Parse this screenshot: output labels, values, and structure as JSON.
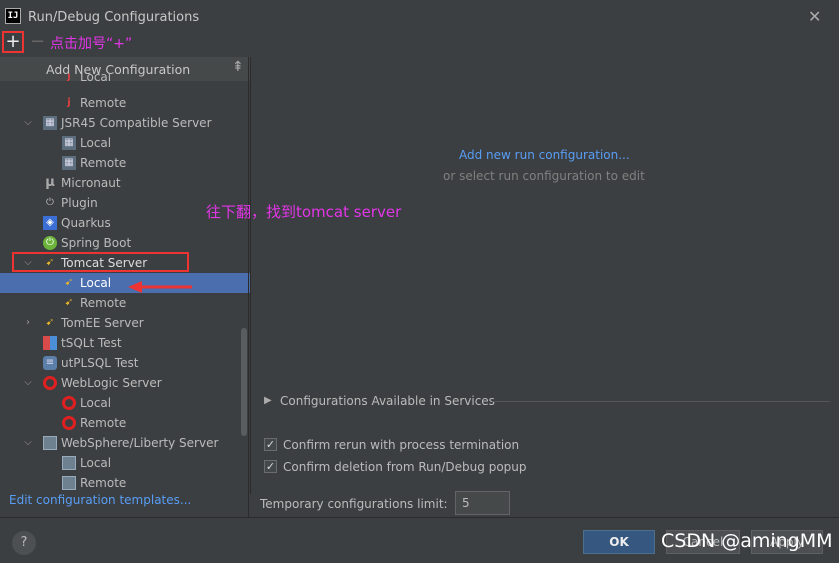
{
  "window": {
    "title": "Run/Debug Configurations",
    "icon": "intellij-icon",
    "close_glyph": "✕"
  },
  "toolbar": {
    "add_label": "+",
    "remove_label": "−"
  },
  "annotations": {
    "click_plus": "点击加号“+”",
    "scroll_down": "往下翻，找到tomcat server"
  },
  "popup": {
    "header": "Add New Configuration",
    "rows": [
      {
        "label": "Local",
        "icon": "jetty-icon"
      },
      {
        "label": "Remote",
        "icon": "jetty-icon"
      },
      {
        "label": "JSR45 Compatible Server",
        "icon": "jsr45-icon"
      },
      {
        "label": "Local",
        "icon": "jsr45-icon"
      },
      {
        "label": "Remote",
        "icon": "jsr45-icon"
      },
      {
        "label": "Micronaut",
        "icon": "micronaut-icon"
      },
      {
        "label": "Plugin",
        "icon": "plugin-icon"
      },
      {
        "label": "Quarkus",
        "icon": "quarkus-icon"
      },
      {
        "label": "Spring Boot",
        "icon": "spring-boot-icon"
      },
      {
        "label": "Tomcat Server",
        "icon": "tomcat-icon"
      },
      {
        "label": "Local",
        "icon": "tomcat-icon"
      },
      {
        "label": "Remote",
        "icon": "tomcat-icon"
      },
      {
        "label": "TomEE Server",
        "icon": "tomee-icon"
      },
      {
        "label": "tSQLt Test",
        "icon": "tsqlt-icon"
      },
      {
        "label": "utPLSQL Test",
        "icon": "utplsql-icon"
      },
      {
        "label": "WebLogic Server",
        "icon": "weblogic-icon"
      },
      {
        "label": "Local",
        "icon": "weblogic-icon"
      },
      {
        "label": "Remote",
        "icon": "weblogic-icon"
      },
      {
        "label": "WebSphere/Liberty Server",
        "icon": "websphere-icon"
      },
      {
        "label": "Local",
        "icon": "websphere-icon"
      },
      {
        "label": "Remote",
        "icon": "websphere-icon"
      }
    ],
    "edit_templates": "Edit configuration templates..."
  },
  "main": {
    "add_new_link": "Add new run configuration...",
    "or_select": "or select run configuration to edit",
    "services_label": "Configurations Available in Services",
    "confirm_rerun": "Confirm rerun with process termination",
    "confirm_deletion": "Confirm deletion from Run/Debug popup",
    "temp_limit_label": "Temporary configurations limit:",
    "temp_limit_value": "5"
  },
  "buttons": {
    "help": "?",
    "ok": "OK",
    "cancel": "Cancel",
    "apply": "Apply"
  },
  "watermark": "CSDN @amingMM",
  "colors": {
    "accent_link": "#589df6",
    "selection": "#4b6eaf",
    "annotation": "#e235e8",
    "highlight": "#ee3333"
  }
}
